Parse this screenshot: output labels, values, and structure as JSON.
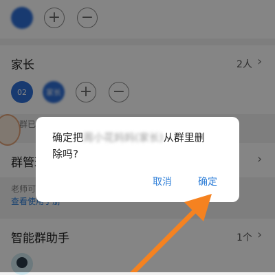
{
  "top_row": {
    "avatar_label": ""
  },
  "parents": {
    "title": "家长",
    "count": "2人",
    "member1": "02",
    "member2": "家长"
  },
  "partial_hint": "该群已",
  "group_manager": {
    "title": "群管理"
  },
  "teacher_note": {
    "text": "老师可",
    "link": "查看使用手册"
  },
  "assistant": {
    "title": "智能群助手",
    "count": "1个"
  },
  "dialog": {
    "message_prefix": "确定把",
    "blurred_name": "周小花妈妈(家长)",
    "message_suffix": "从群里删",
    "message_line2": "除吗?",
    "cancel_label": "取消",
    "confirm_label": "确定"
  },
  "colors": {
    "accent": "#2f7fd8",
    "avatar_blue": "#2f6fd6",
    "arrow_orange": "#f58220"
  }
}
